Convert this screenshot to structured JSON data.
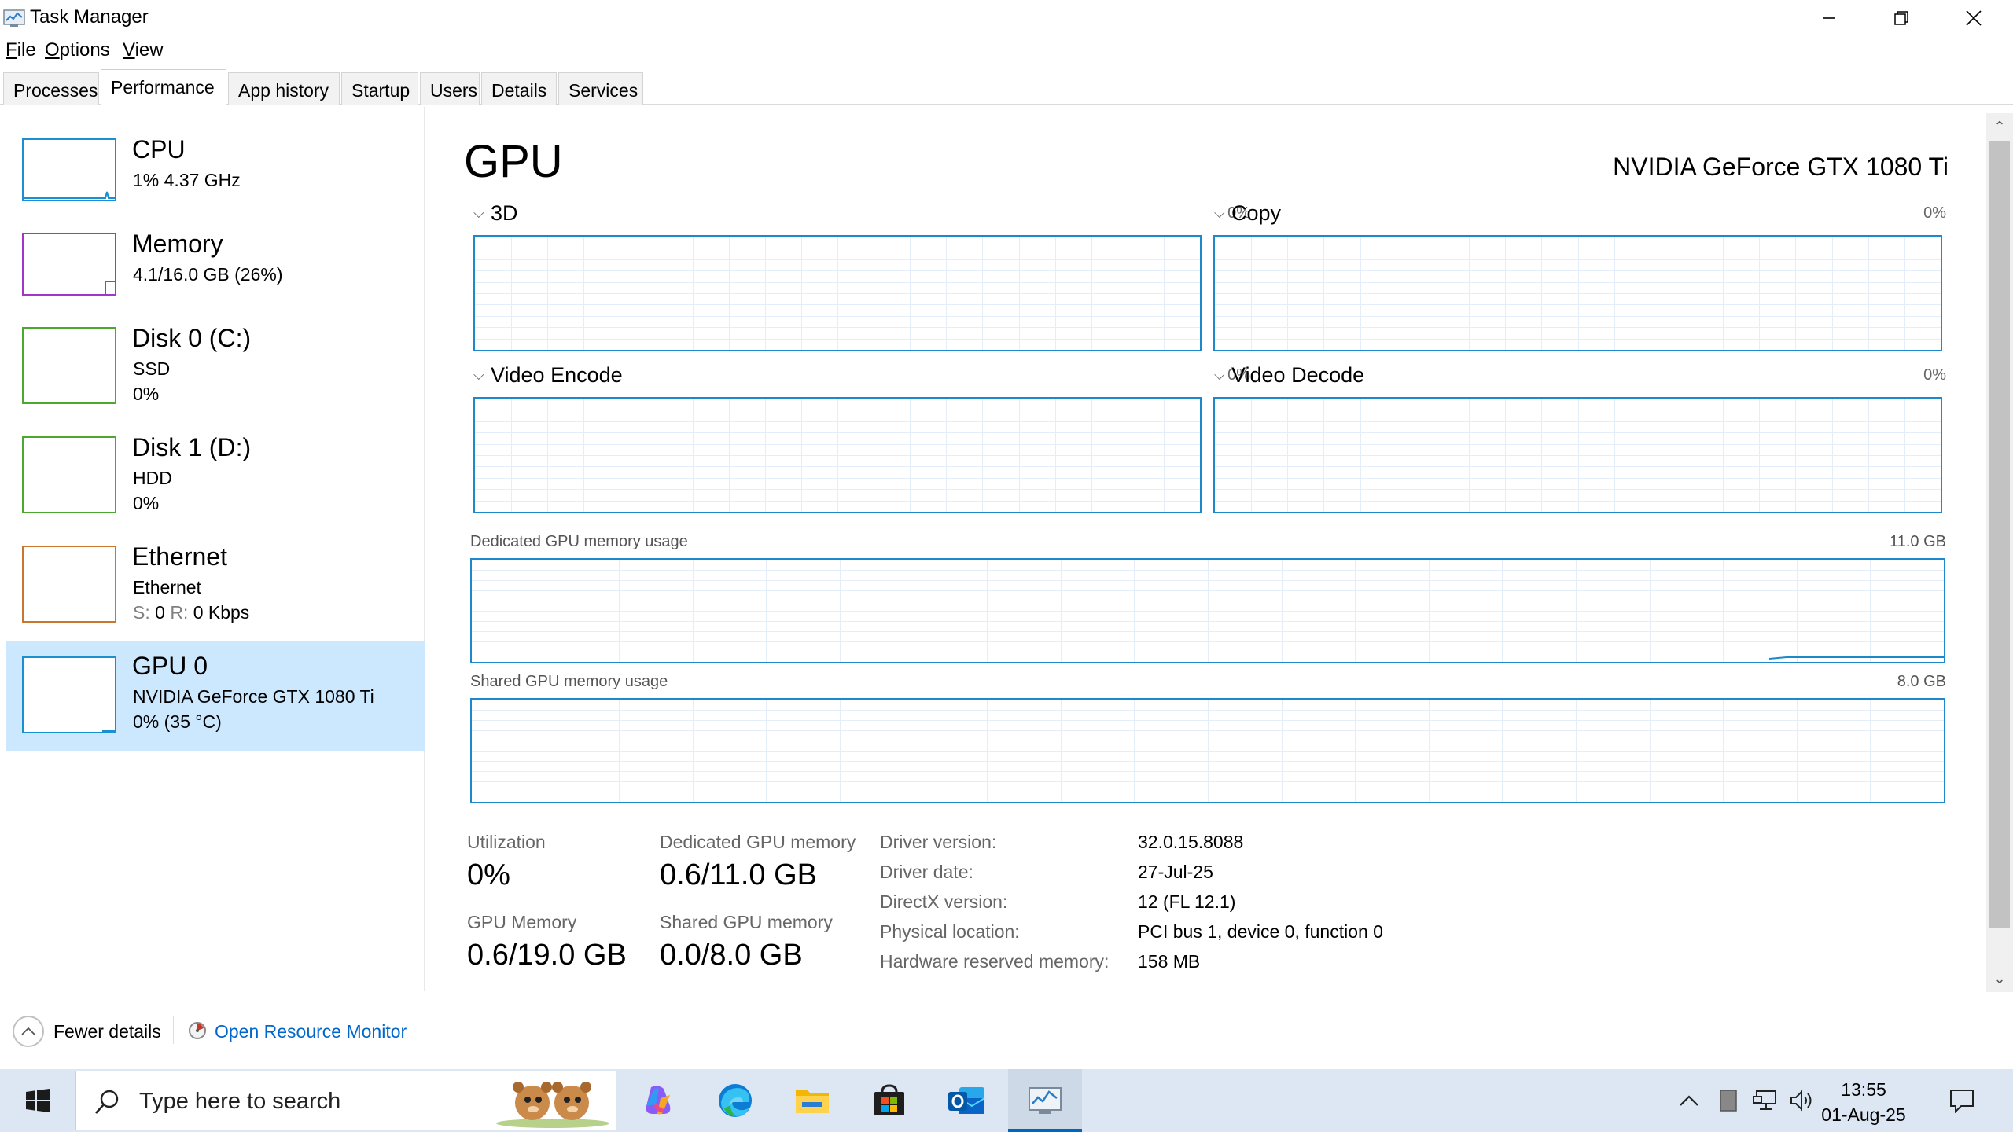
{
  "window": {
    "title": "Task Manager",
    "icons": {
      "app": "task-manager-icon",
      "minimize": "minimize-icon",
      "restore": "restore-icon",
      "close": "close-icon"
    }
  },
  "menu": [
    {
      "u": "F",
      "rest": "ile"
    },
    {
      "u": "O",
      "rest": "ptions"
    },
    {
      "u": "V",
      "rest": "iew"
    }
  ],
  "tabs": [
    "Processes",
    "Performance",
    "App history",
    "Startup",
    "Users",
    "Details",
    "Services"
  ],
  "active_tab": "Performance",
  "sidebar": {
    "items": [
      {
        "title": "CPU",
        "line1": "1%  4.37 GHz",
        "line2": "",
        "color": "#1a8fd1"
      },
      {
        "title": "Memory",
        "line1": "4.1/16.0 GB (26%)",
        "line2": "",
        "color": "#a236c8"
      },
      {
        "title": "Disk 0 (C:)",
        "line1": "SSD",
        "line2": "0%",
        "color": "#4ea72e"
      },
      {
        "title": "Disk 1 (D:)",
        "line1": "HDD",
        "line2": "0%",
        "color": "#4ea72e"
      },
      {
        "title": "Ethernet",
        "line1": "Ethernet",
        "line2_s": "S:",
        "line2_sv": "0",
        "line2_r": "R:",
        "line2_rv": "0 Kbps",
        "color": "#c9772e"
      },
      {
        "title": "GPU 0",
        "line1": "NVIDIA GeForce GTX 1080 Ti",
        "line2": "0%  (35 °C)",
        "color": "#1a8fd1"
      }
    ]
  },
  "gpu": {
    "title": "GPU",
    "name": "NVIDIA GeForce GTX 1080 Ti",
    "engines": [
      {
        "label": "3D",
        "pct": "0%"
      },
      {
        "label": "Copy",
        "pct": "0%"
      },
      {
        "label": "Video Encode",
        "pct": "0%"
      },
      {
        "label": "Video Decode",
        "pct": "0%"
      }
    ],
    "dedicated_graph": {
      "label": "Dedicated GPU memory usage",
      "max": "11.0 GB"
    },
    "shared_graph": {
      "label": "Shared GPU memory usage",
      "max": "8.0 GB"
    },
    "stats": {
      "utilization_label": "Utilization",
      "utilization": "0%",
      "dedicated_label": "Dedicated GPU memory",
      "dedicated": "0.6/11.0 GB",
      "gpu_memory_label": "GPU Memory",
      "gpu_memory": "0.6/19.0 GB",
      "shared_label": "Shared GPU memory",
      "shared": "0.0/8.0 GB"
    },
    "driver": [
      {
        "key": "Driver version:",
        "value": "32.0.15.8088"
      },
      {
        "key": "Driver date:",
        "value": "27-Jul-25"
      },
      {
        "key": "DirectX version:",
        "value": "12 (FL 12.1)"
      },
      {
        "key": "Physical location:",
        "value": "PCI bus 1, device 0, function 0"
      },
      {
        "key": "Hardware reserved memory:",
        "value": "158 MB"
      }
    ],
    "accent_color": "#1e88cc"
  },
  "footer": {
    "fewer_details": "Fewer details",
    "open_resource_monitor": "Open Resource Monitor"
  },
  "taskbar": {
    "search_placeholder": "Type here to search",
    "apps": [
      "windows-start-icon",
      "copilot-icon",
      "edge-icon",
      "file-explorer-icon",
      "microsoft-store-icon",
      "outlook-icon",
      "task-manager-icon"
    ],
    "tray": [
      "chevron-up-icon",
      "battery-icon",
      "network-icon",
      "volume-icon"
    ],
    "time": "13:55",
    "date": "01-Aug-25"
  }
}
